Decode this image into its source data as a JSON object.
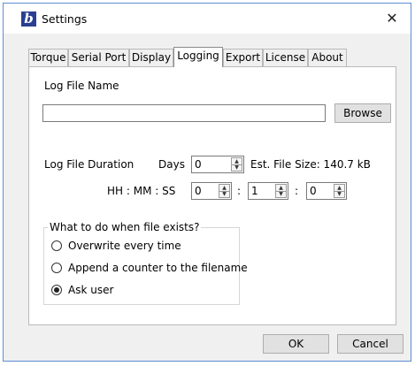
{
  "window": {
    "title": "Settings",
    "app_icon_letter": "b",
    "close_glyph": "✕"
  },
  "tabs": [
    {
      "label": "Torque"
    },
    {
      "label": "Serial Port"
    },
    {
      "label": "Display"
    },
    {
      "label": "Logging",
      "active": true
    },
    {
      "label": "Export"
    },
    {
      "label": "License"
    },
    {
      "label": "About"
    }
  ],
  "logging": {
    "log_file_name_label": "Log File Name",
    "log_file_name_value": "",
    "browse_label": "Browse",
    "duration_label": "Log File Duration",
    "days_label": "Days",
    "days_value": "0",
    "est_size_label": "Est. File Size: 140.7  kB",
    "hms_label": "HH : MM : SS",
    "hours_value": "0",
    "minutes_value": "1",
    "seconds_value": "0",
    "colon": ":",
    "group_title": "What to do when file exists?",
    "options": [
      {
        "label": "Overwrite every time",
        "selected": false
      },
      {
        "label": "Append a counter to the filename",
        "selected": false
      },
      {
        "label": "Ask user",
        "selected": true
      }
    ]
  },
  "footer": {
    "ok_label": "OK",
    "cancel_label": "Cancel"
  },
  "icons": {
    "spin_up": "up-arrow-icon",
    "spin_down": "down-arrow-icon"
  },
  "colors": {
    "window_border": "#5b8fd0",
    "app_icon": "#2a3f92",
    "dialog_bg": "#f0f0f0",
    "button_bg": "#e1e1e1"
  }
}
